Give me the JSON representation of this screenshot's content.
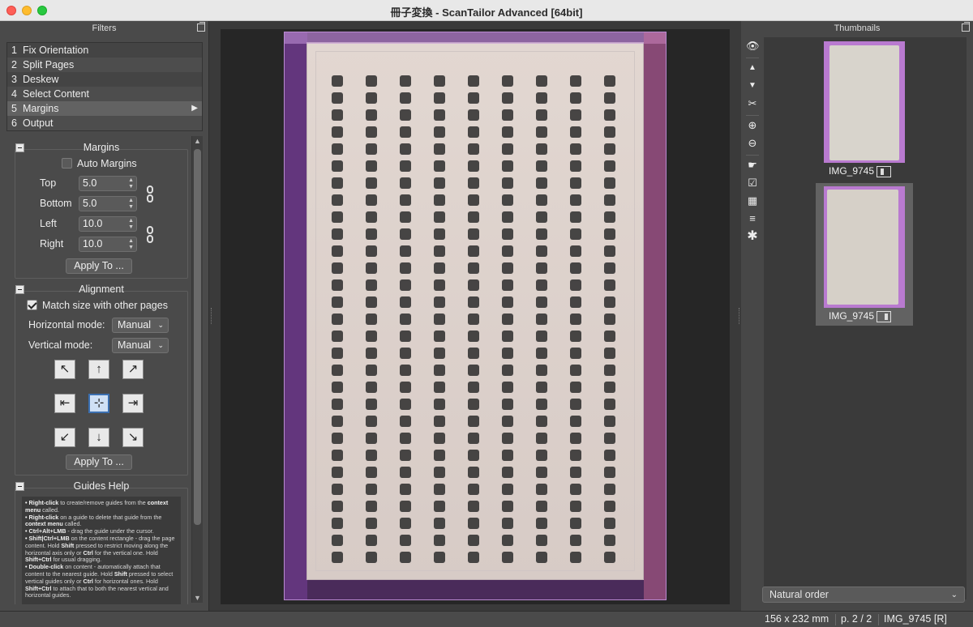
{
  "window": {
    "title": "冊子変換 - ScanTailor Advanced [64bit]"
  },
  "filters_panel": {
    "title": "Filters",
    "stages": [
      {
        "num": "1",
        "label": "Fix Orientation"
      },
      {
        "num": "2",
        "label": "Split Pages"
      },
      {
        "num": "3",
        "label": "Deskew"
      },
      {
        "num": "4",
        "label": "Select Content"
      },
      {
        "num": "5",
        "label": "Margins",
        "selected": true
      },
      {
        "num": "6",
        "label": "Output"
      }
    ]
  },
  "margins_group": {
    "title": "Margins",
    "auto_margins_label": "Auto Margins",
    "auto_margins_checked": false,
    "top_label": "Top",
    "top_value": "5.0",
    "bottom_label": "Bottom",
    "bottom_value": "5.0",
    "left_label": "Left",
    "left_value": "10.0",
    "right_label": "Right",
    "right_value": "10.0",
    "apply_label": "Apply To ..."
  },
  "alignment_group": {
    "title": "Alignment",
    "match_size_label": "Match size with other pages",
    "match_size_checked": true,
    "horizontal_mode_label": "Horizontal mode:",
    "horizontal_mode_value": "Manual",
    "vertical_mode_label": "Vertical mode:",
    "vertical_mode_value": "Manual",
    "apply_label": "Apply To ..."
  },
  "guides_help": {
    "title": "Guides Help",
    "lines": [
      {
        "b": "• Right-click",
        "t": " to create/remove guides from the "
      },
      {
        "b": "context menu",
        "t": " called."
      },
      {
        "b": "• Right-click",
        "t": " on a guide to delete that guide from the "
      },
      {
        "b": "context menu",
        "t": " called."
      },
      {
        "b": "• Ctrl+Alt+LMB",
        "t": " - drag the guide under the cursor."
      },
      {
        "b": "• Shift|Ctrl+LMB",
        "t": " on the content rectangle - drag the page content. Hold "
      },
      {
        "b": "Shift",
        "t": " pressed to restrict moving along the horizontal axis only or "
      },
      {
        "b": "Ctrl",
        "t": " for the vertical one. Hold "
      },
      {
        "b": "Shift+Ctrl",
        "t": " for usual dragging."
      },
      {
        "b": "• Double-click",
        "t": " on content - automatically attach that content to the nearest guide. Hold "
      },
      {
        "b": "Shift",
        "t": " pressed to select vertical guides only or "
      },
      {
        "b": "Ctrl",
        "t": " for horizontal ones. Hold "
      },
      {
        "b": "Shift+Ctrl",
        "t": " to attach that to both the nearest vertical and horizontal guides."
      }
    ]
  },
  "thumbnails_panel": {
    "title": "Thumbnails",
    "items": [
      {
        "caption": "IMG_9745",
        "side": "left"
      },
      {
        "caption": "IMG_9745",
        "side": "right",
        "selected": true
      }
    ],
    "sort_order": "Natural order"
  },
  "status_bar": {
    "dimensions": "156 x 232 mm",
    "page": "p. 2 / 2",
    "file": "IMG_9745 [R]"
  },
  "colors": {
    "content_outline": "#b98ad1",
    "selection_blue": "#3b6fb0",
    "thumb_purple": "#b97ad0"
  }
}
